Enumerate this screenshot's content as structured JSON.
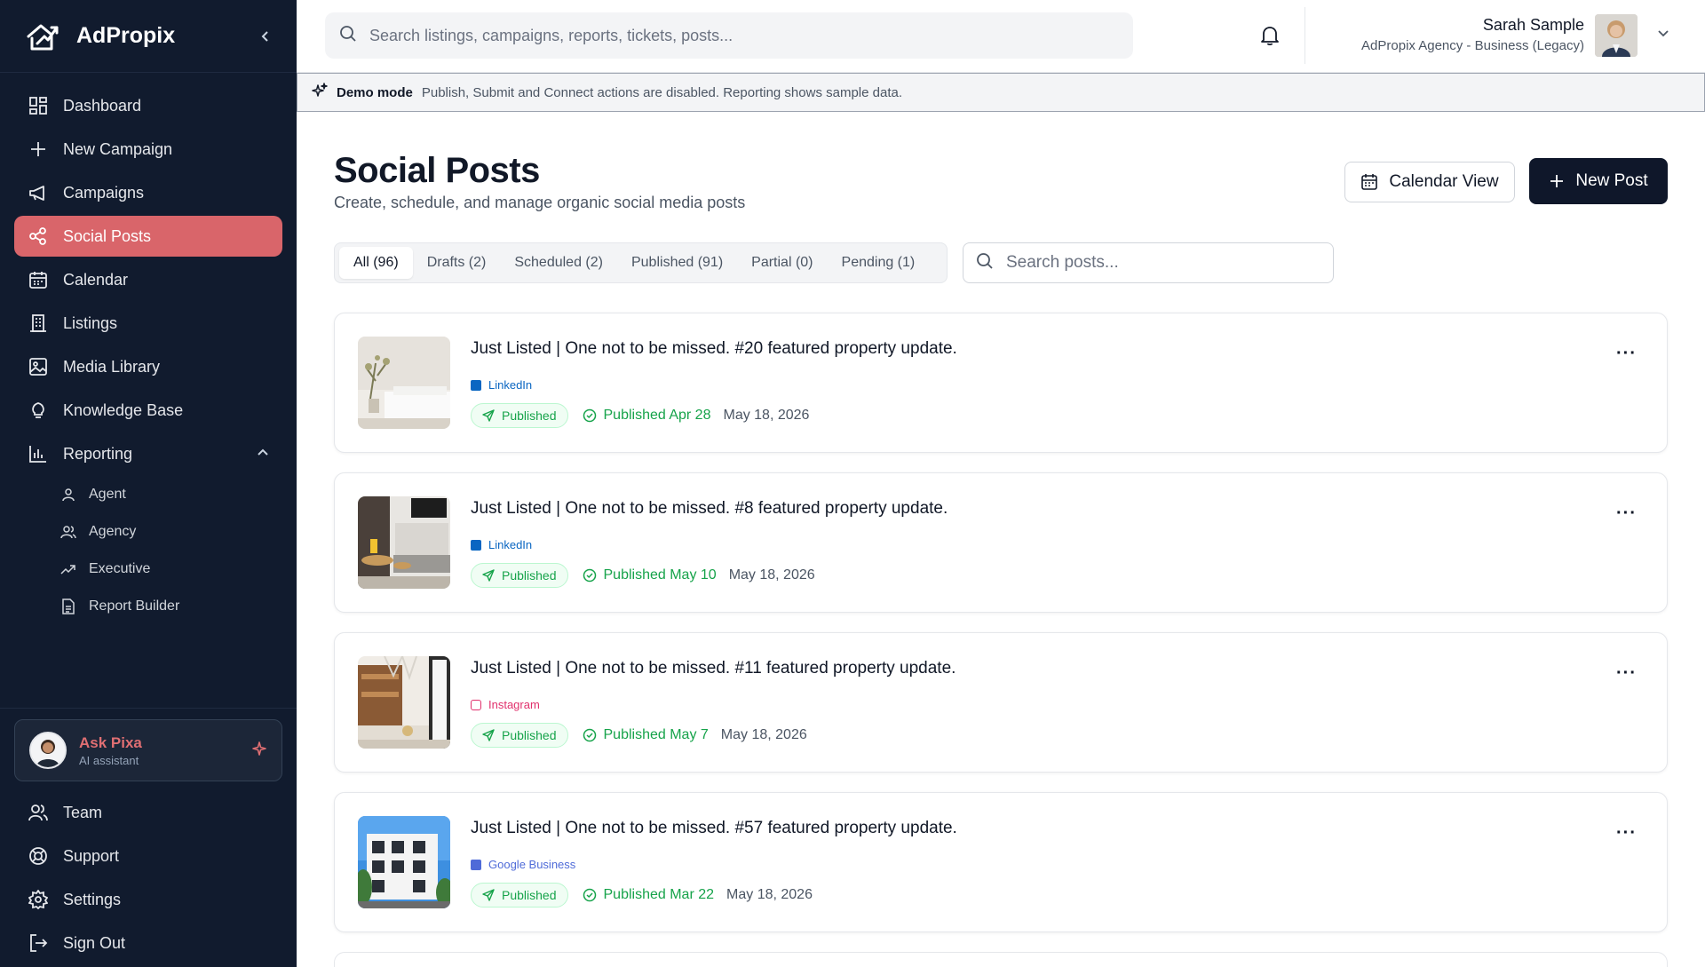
{
  "brand": {
    "name": "AdPropix"
  },
  "sidebar": {
    "items": [
      {
        "label": "Dashboard",
        "icon": "dashboard-icon"
      },
      {
        "label": "New Campaign",
        "icon": "plus-icon"
      },
      {
        "label": "Campaigns",
        "icon": "megaphone-icon"
      },
      {
        "label": "Social Posts",
        "icon": "share-icon",
        "active": true
      },
      {
        "label": "Calendar",
        "icon": "calendar-icon"
      },
      {
        "label": "Listings",
        "icon": "building-icon"
      },
      {
        "label": "Media Library",
        "icon": "image-icon"
      },
      {
        "label": "Knowledge Base",
        "icon": "lightbulb-icon"
      },
      {
        "label": "Reporting",
        "icon": "bar-chart-icon"
      }
    ],
    "reporting_sub": [
      {
        "label": "Agent",
        "icon": "user-icon"
      },
      {
        "label": "Agency",
        "icon": "users-icon"
      },
      {
        "label": "Executive",
        "icon": "trend-icon"
      },
      {
        "label": "Report Builder",
        "icon": "file-icon"
      }
    ],
    "assistant": {
      "name": "Ask Pixa",
      "subtitle": "AI assistant"
    },
    "bottom": [
      {
        "label": "Team",
        "icon": "team-icon"
      },
      {
        "label": "Support",
        "icon": "lifebuoy-icon"
      },
      {
        "label": "Settings",
        "icon": "gear-icon"
      },
      {
        "label": "Sign Out",
        "icon": "sign-out-icon"
      }
    ]
  },
  "topbar": {
    "search_placeholder": "Search listings, campaigns, reports, tickets, posts...",
    "user_name": "Sarah Sample",
    "user_account": "AdPropix Agency - Business (Legacy)"
  },
  "demo": {
    "title": "Demo mode",
    "text": "Publish, Submit and Connect actions are disabled. Reporting shows sample data."
  },
  "page": {
    "title": "Social Posts",
    "subtitle": "Create, schedule, and manage organic social media posts",
    "calendar_btn": "Calendar View",
    "new_btn": "New Post",
    "search_placeholder": "Search posts..."
  },
  "tabs": [
    {
      "label": "All (96)",
      "active": true
    },
    {
      "label": "Drafts (2)"
    },
    {
      "label": "Scheduled (2)"
    },
    {
      "label": "Published (91)"
    },
    {
      "label": "Partial (0)"
    },
    {
      "label": "Pending (1)"
    }
  ],
  "colors": {
    "linkedin": "#0a66c2",
    "instagram": "#e1306c",
    "google": "#4f6bd8",
    "accent": "#d9656a",
    "success": "#16a34a"
  },
  "posts": [
    {
      "title": "Just Listed | One not to be missed. #20 featured property update.",
      "platform": "LinkedIn",
      "status": "Published",
      "published": "Published Apr 28",
      "date": "May 18, 2026"
    },
    {
      "title": "Just Listed | One not to be missed. #8 featured property update.",
      "platform": "LinkedIn",
      "status": "Published",
      "published": "Published May 10",
      "date": "May 18, 2026"
    },
    {
      "title": "Just Listed | One not to be missed. #11 featured property update.",
      "platform": "Instagram",
      "status": "Published",
      "published": "Published May 7",
      "date": "May 18, 2026"
    },
    {
      "title": "Just Listed | One not to be missed. #57 featured property update.",
      "platform": "Google Business",
      "status": "Published",
      "published": "Published Mar 22",
      "date": "May 18, 2026"
    }
  ]
}
